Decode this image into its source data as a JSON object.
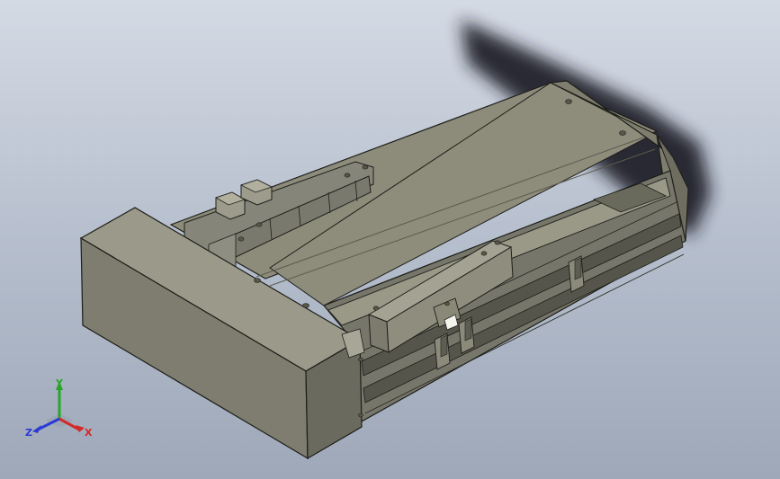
{
  "viewport": {
    "background_top": "#d4dae4",
    "background_bottom": "#9ea8b8",
    "model_color": "#8a8a78",
    "model_edge_color": "#1e1e1a"
  },
  "triad": {
    "x_label": "X",
    "y_label": "Y",
    "z_label": "Z",
    "x_color": "#d42a2a",
    "y_color": "#2aa52a",
    "z_color": "#2a3ad4"
  }
}
